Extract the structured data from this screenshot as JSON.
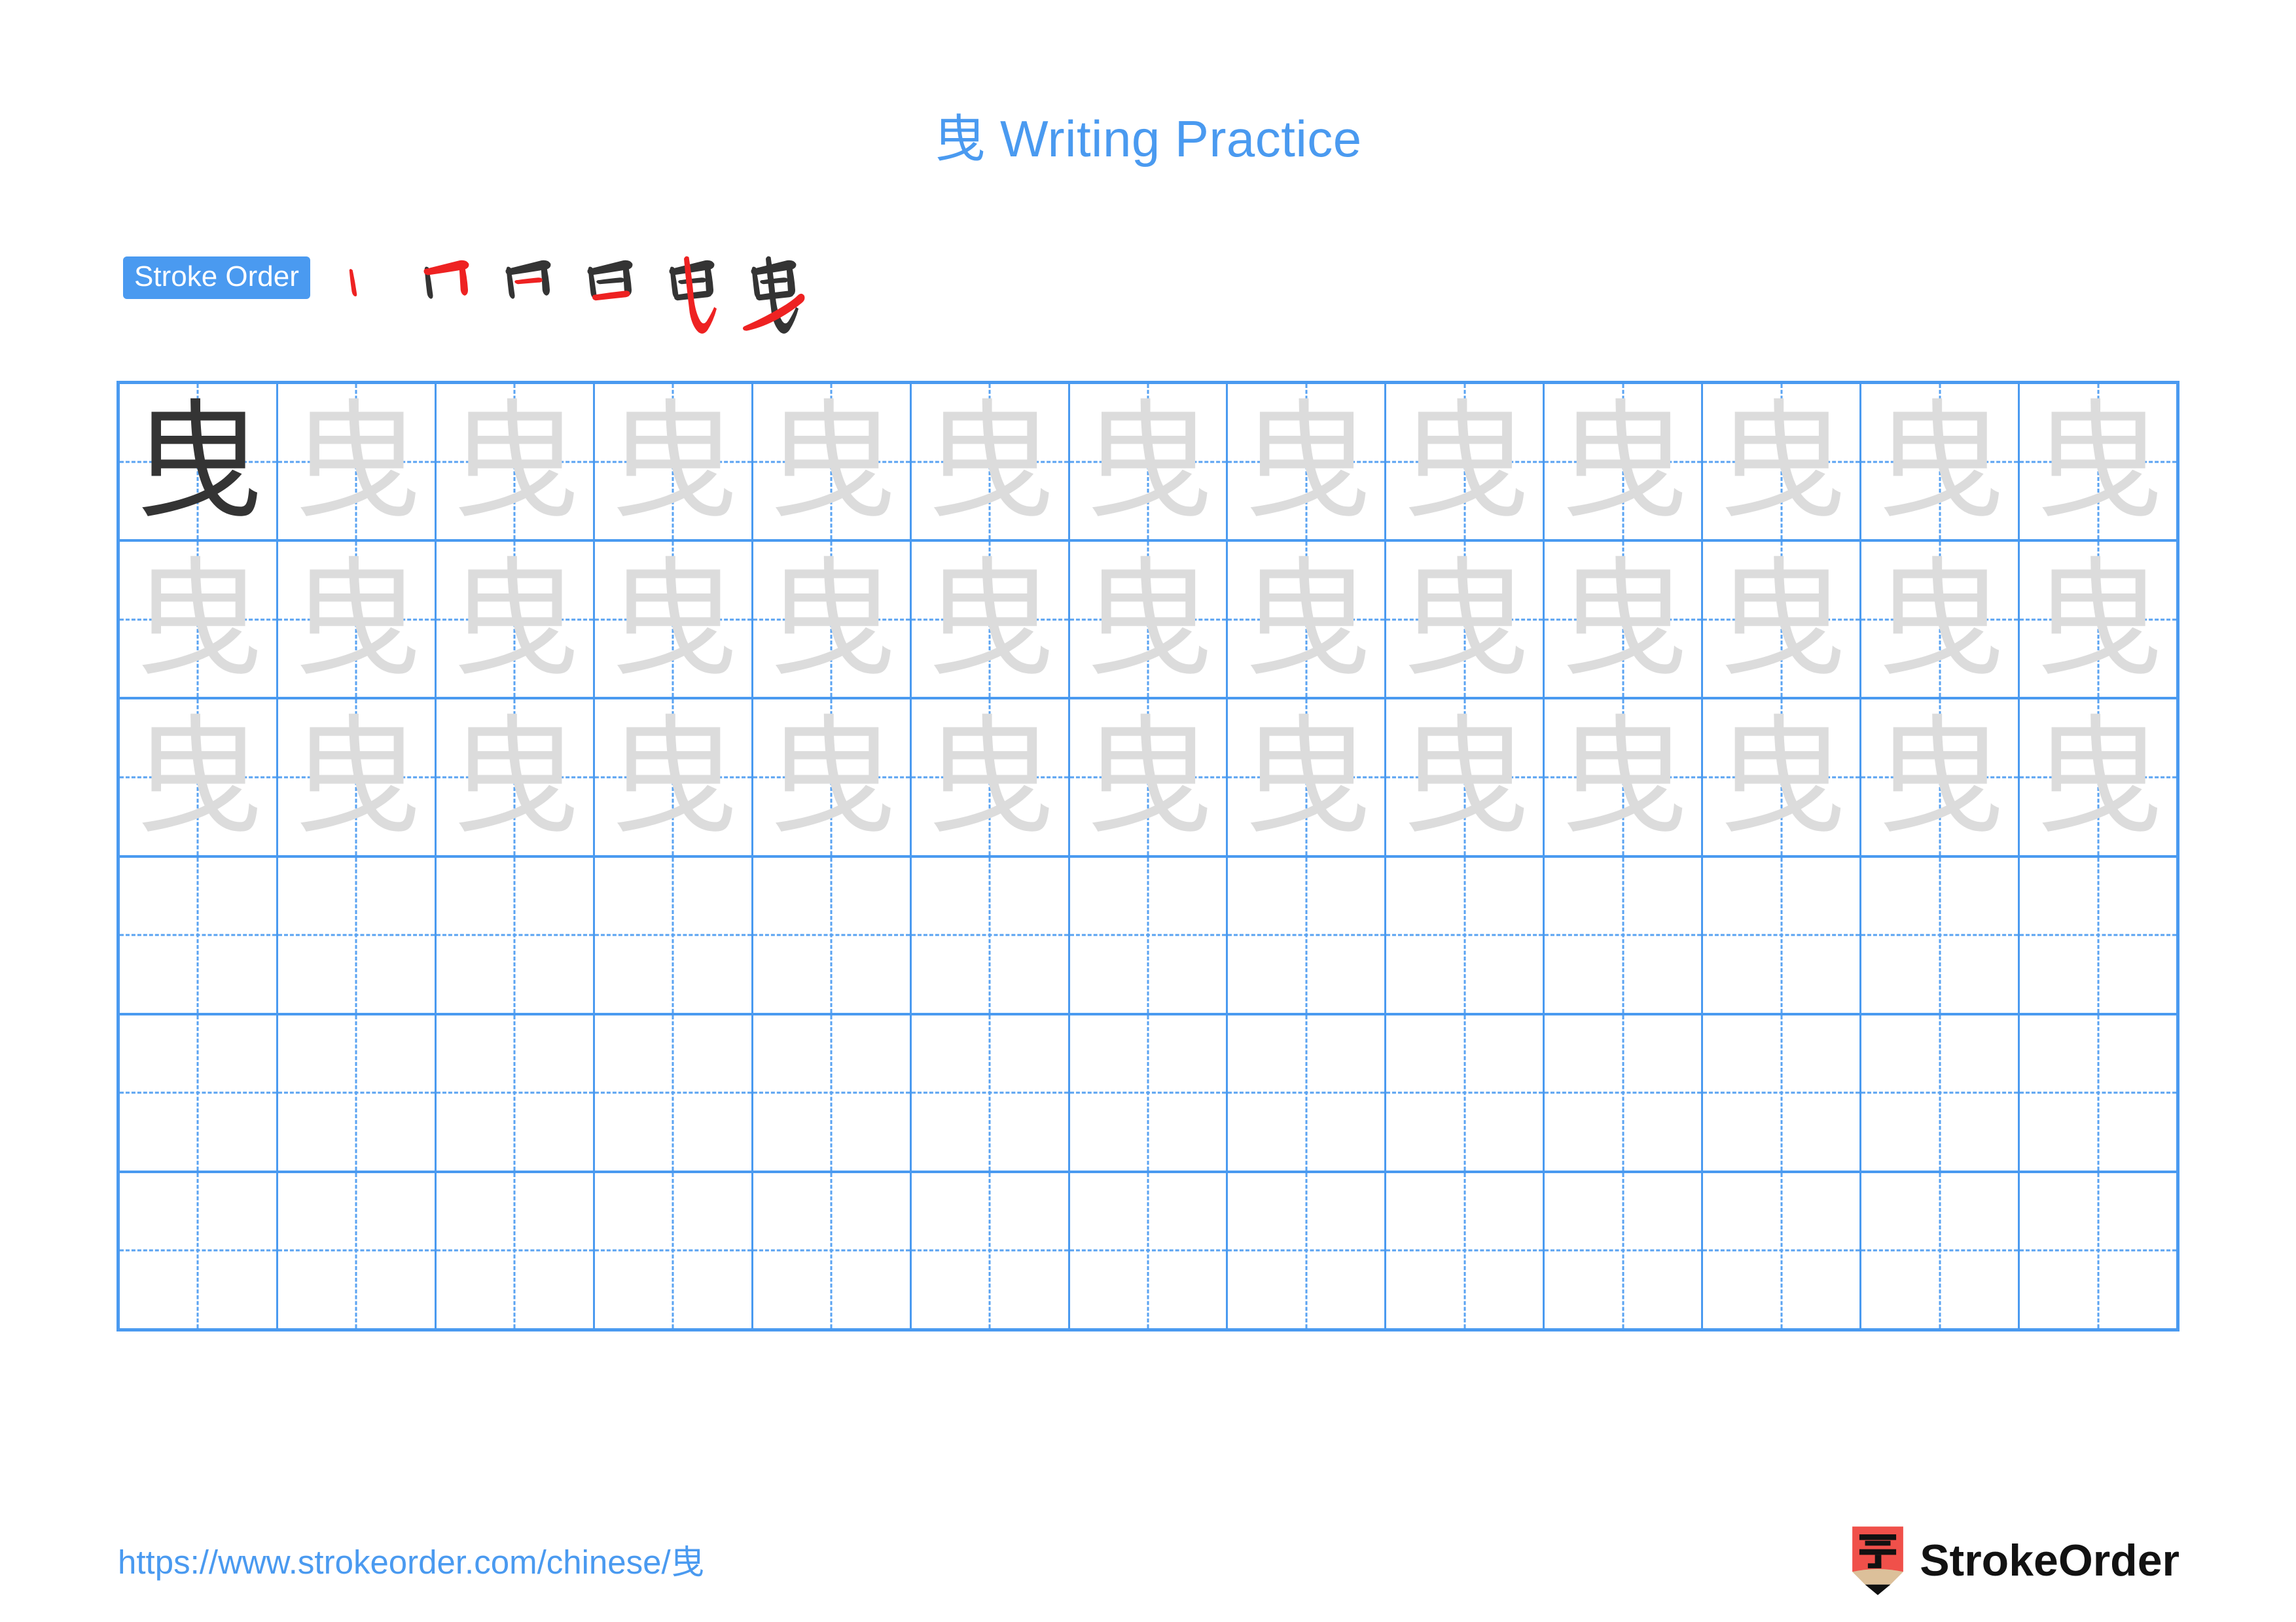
{
  "character": "曳",
  "title": "曳 Writing Practice",
  "colors": {
    "accent_blue": "#4a9af0",
    "grid_line": "#4a9af0",
    "guide_dash": "#5aa3f2",
    "model_char": "#343434",
    "trace_char": "#dcdcdc",
    "stroke_done": "#343434",
    "stroke_new": "#ee2222",
    "logo_red": "#f0504a",
    "logo_wood": "#dcc09a",
    "logo_text": "#121212"
  },
  "stroke_order": {
    "badge_label": "Stroke Order",
    "total_strokes": 6,
    "steps": [
      {
        "index": 1,
        "name": "stroke-step-1",
        "new_stroke": "dot-vertical-left",
        "strokes_shown": 1
      },
      {
        "index": 2,
        "name": "stroke-step-2",
        "new_stroke": "horizontal-with-right-vertical",
        "strokes_shown": 2
      },
      {
        "index": 3,
        "name": "stroke-step-3",
        "new_stroke": "inner-short-horizontal",
        "strokes_shown": 3
      },
      {
        "index": 4,
        "name": "stroke-step-4",
        "new_stroke": "bottom-horizontal-closing-sun",
        "strokes_shown": 4
      },
      {
        "index": 5,
        "name": "stroke-step-5",
        "new_stroke": "long-vertical-hook",
        "strokes_shown": 5
      },
      {
        "index": 6,
        "name": "stroke-step-6",
        "new_stroke": "long-diagonal-sweep",
        "strokes_shown": 6
      }
    ]
  },
  "practice_grid": {
    "columns": 13,
    "rows": 6,
    "cells": [
      [
        "dark",
        "light",
        "light",
        "light",
        "light",
        "light",
        "light",
        "light",
        "light",
        "light",
        "light",
        "light",
        "light"
      ],
      [
        "light",
        "light",
        "light",
        "light",
        "light",
        "light",
        "light",
        "light",
        "light",
        "light",
        "light",
        "light",
        "light"
      ],
      [
        "light",
        "light",
        "light",
        "light",
        "light",
        "light",
        "light",
        "light",
        "light",
        "light",
        "light",
        "light",
        "light"
      ],
      [
        "empty",
        "empty",
        "empty",
        "empty",
        "empty",
        "empty",
        "empty",
        "empty",
        "empty",
        "empty",
        "empty",
        "empty",
        "empty"
      ],
      [
        "empty",
        "empty",
        "empty",
        "empty",
        "empty",
        "empty",
        "empty",
        "empty",
        "empty",
        "empty",
        "empty",
        "empty",
        "empty"
      ],
      [
        "empty",
        "empty",
        "empty",
        "empty",
        "empty",
        "empty",
        "empty",
        "empty",
        "empty",
        "empty",
        "empty",
        "empty",
        "empty"
      ]
    ]
  },
  "footer": {
    "url": "https://www.strokeorder.com/chinese/曳",
    "brand_name": "StrokeOrder",
    "logo_char": "字"
  }
}
